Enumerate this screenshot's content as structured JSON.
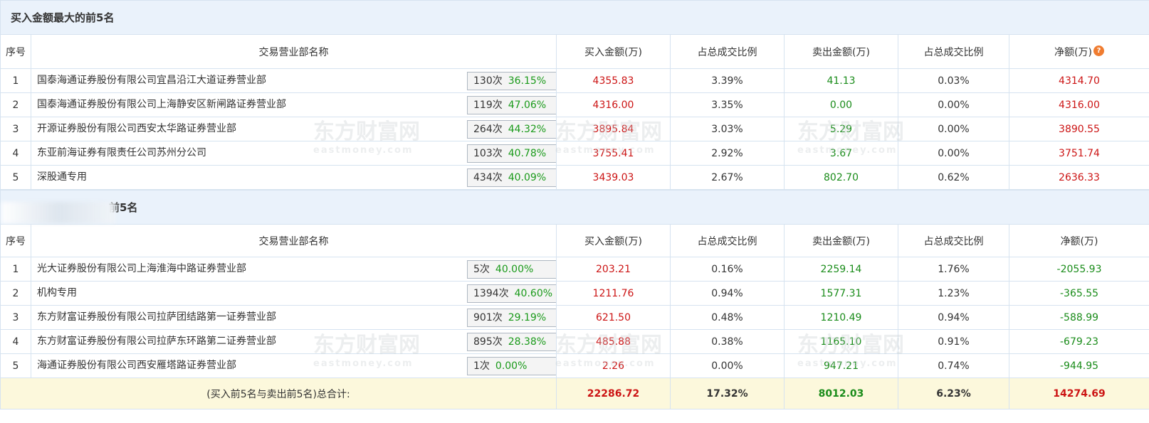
{
  "buy_section": {
    "title": "买入金额最大的前5名",
    "headers": [
      "序号",
      "交易营业部名称",
      "买入金额(万)",
      "占总成交比例",
      "卖出金额(万)",
      "占总成交比例",
      "净额(万)"
    ],
    "rows": [
      {
        "idx": "1",
        "name": "国泰海通证券股份有限公司宜昌沿江大道证券营业部",
        "count": "130次",
        "pct": "36.15%",
        "icon": "help-icon",
        "buy": "4355.83",
        "buy_ratio": "3.39%",
        "sell": "41.13",
        "sell_ratio": "0.03%",
        "net": "4314.70"
      },
      {
        "idx": "2",
        "name": "国泰海通证券股份有限公司上海静安区新闸路证券营业部",
        "count": "119次",
        "pct": "47.06%",
        "icon": "arrow-icon",
        "buy": "4316.00",
        "buy_ratio": "3.35%",
        "sell": "0.00",
        "sell_ratio": "0.00%",
        "net": "4316.00"
      },
      {
        "idx": "3",
        "name": "开源证券股份有限公司西安太华路证券营业部",
        "count": "264次",
        "pct": "44.32%",
        "icon": "arrow-icon",
        "buy": "3895.84",
        "buy_ratio": "3.03%",
        "sell": "5.29",
        "sell_ratio": "0.00%",
        "net": "3890.55"
      },
      {
        "idx": "4",
        "name": "东亚前海证券有限责任公司苏州分公司",
        "count": "103次",
        "pct": "40.78%",
        "icon": "arrow-icon",
        "buy": "3755.41",
        "buy_ratio": "2.92%",
        "sell": "3.67",
        "sell_ratio": "0.00%",
        "net": "3751.74"
      },
      {
        "idx": "5",
        "name": "深股通专用",
        "count": "434次",
        "pct": "40.09%",
        "icon": "arrow-icon",
        "buy": "3439.03",
        "buy_ratio": "2.67%",
        "sell": "802.70",
        "sell_ratio": "0.62%",
        "net": "2636.33"
      }
    ]
  },
  "sell_section": {
    "title_visible": "前5名",
    "headers": [
      "序号",
      "交易营业部名称",
      "买入金额(万)",
      "占总成交比例",
      "卖出金额(万)",
      "占总成交比例",
      "净额(万)"
    ],
    "rows": [
      {
        "idx": "1",
        "name": "光大证券股份有限公司上海淮海中路证券营业部",
        "count": "5次",
        "pct": "40.00%",
        "icon": "help-icon",
        "buy": "203.21",
        "buy_ratio": "0.16%",
        "sell": "2259.14",
        "sell_ratio": "1.76%",
        "net": "-2055.93"
      },
      {
        "idx": "2",
        "name": "机构专用",
        "count": "1394次",
        "pct": "40.60%",
        "icon": "arrow-icon",
        "buy": "1211.76",
        "buy_ratio": "0.94%",
        "sell": "1577.31",
        "sell_ratio": "1.23%",
        "net": "-365.55"
      },
      {
        "idx": "3",
        "name": "东方财富证券股份有限公司拉萨团结路第一证券营业部",
        "count": "901次",
        "pct": "29.19%",
        "icon": "arrow-icon",
        "buy": "621.50",
        "buy_ratio": "0.48%",
        "sell": "1210.49",
        "sell_ratio": "0.94%",
        "net": "-588.99"
      },
      {
        "idx": "4",
        "name": "东方财富证券股份有限公司拉萨东环路第二证券营业部",
        "count": "895次",
        "pct": "28.38%",
        "icon": "arrow-icon",
        "buy": "485.88",
        "buy_ratio": "0.38%",
        "sell": "1165.10",
        "sell_ratio": "0.91%",
        "net": "-679.23"
      },
      {
        "idx": "5",
        "name": "海通证券股份有限公司西安雁塔路证券营业部",
        "count": "1次",
        "pct": "0.00%",
        "icon": "arrow-icon",
        "buy": "2.26",
        "buy_ratio": "0.00%",
        "sell": "947.21",
        "sell_ratio": "0.74%",
        "net": "-944.95"
      }
    ]
  },
  "total": {
    "label": "(买入前5名与卖出前5名)总合计:",
    "buy": "22286.72",
    "buy_ratio": "17.32%",
    "sell": "8012.03",
    "sell_ratio": "6.23%",
    "net": "14274.69"
  },
  "help_glyph": "?",
  "watermark": {
    "cn": "东方财富网",
    "en": "eastmoney.com"
  },
  "colors": {
    "positive": "#cc1414",
    "negative": "#1a8c1a",
    "header_bg": "#eaf2fb",
    "total_bg": "#fcf8dc",
    "help_icon": "#f07c30"
  }
}
